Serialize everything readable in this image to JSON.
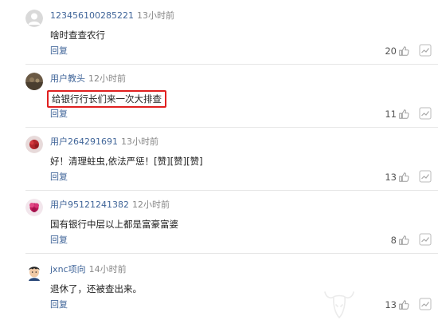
{
  "comments": [
    {
      "user": "123456100285221",
      "time": "13小时前",
      "content": "啥时查查农行",
      "reply": "回复",
      "likes": "20",
      "highlighted": false,
      "avatar": "default-avatar"
    },
    {
      "user": "用户教头",
      "time": "12小时前",
      "content": "给银行行长们来一次大排查",
      "reply": "回复",
      "likes": "11",
      "highlighted": true,
      "avatar": "photo-avatar"
    },
    {
      "user": "用户264291691",
      "time": "13小时前",
      "content": "好！清理蛀虫,依法严惩！[赞][赞][赞]",
      "reply": "回复",
      "likes": "13",
      "highlighted": false,
      "avatar": "flower-avatar"
    },
    {
      "user": "用户95121241382",
      "time": "12小时前",
      "content": "国有银行中层以上都是富豪富婆",
      "reply": "回复",
      "likes": "8",
      "highlighted": false,
      "avatar": "pink-flower-avatar"
    },
    {
      "user": "jxnc项向",
      "time": "14小时前",
      "content": "退休了，还被查出来。",
      "reply": "回复",
      "likes": "13",
      "highlighted": false,
      "avatar": "cartoon-avatar"
    }
  ],
  "colors": {
    "username": "#406599",
    "highlight_border": "#e02020",
    "time": "#888888"
  },
  "icons": {
    "like": "thumbs-up-icon",
    "trend": "trend-icon"
  }
}
